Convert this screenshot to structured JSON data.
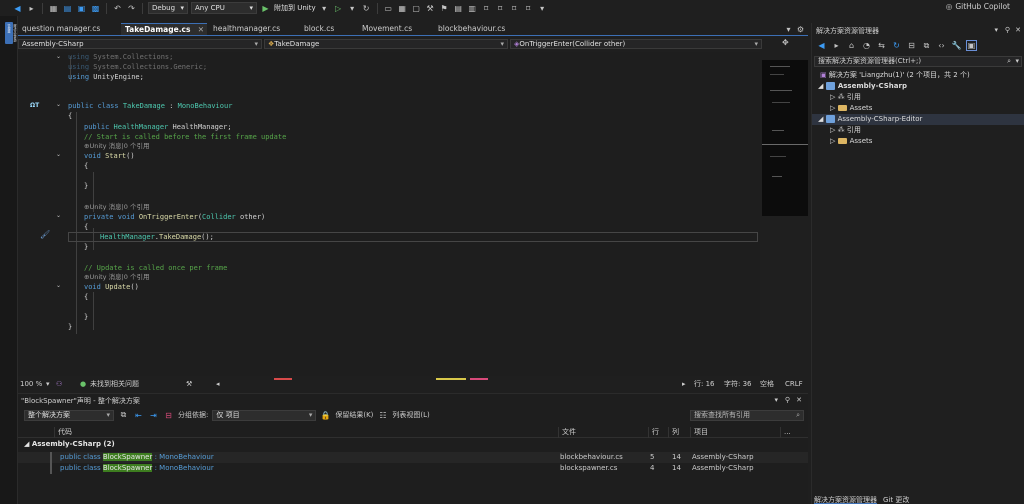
{
  "toolbar": {
    "configuration": "Debug",
    "platform": "Any CPU",
    "attach_label": "附加到 Unity",
    "copilot_label": "GitHub Copilot"
  },
  "left_strip": {
    "label": "解决方案资源管理器"
  },
  "doc_tabs": [
    {
      "label": "question manager.cs",
      "active": false
    },
    {
      "label": "TakeDamage.cs",
      "active": true
    },
    {
      "label": "healthmanager.cs",
      "active": false
    },
    {
      "label": "block.cs",
      "active": false
    },
    {
      "label": "Movement.cs",
      "active": false
    },
    {
      "label": "blockbehaviour.cs",
      "active": false
    }
  ],
  "nav_bar": {
    "project": "Assembly-CSharp",
    "class": "TakeDamage",
    "member": "OnTriggerEnter(Collider other)"
  },
  "code": {
    "l1": [
      "using",
      " System.Collections;"
    ],
    "l2": [
      "using",
      " System.Collections.Generic;"
    ],
    "l3": [
      "using",
      " UnityEngine;"
    ],
    "class_decl": [
      "public",
      "class",
      "TakeDamage",
      ":",
      "MonoBehaviour"
    ],
    "brace_open": "{",
    "field": [
      "public",
      "HealthManager",
      "HealthManager;"
    ],
    "comment_start": "// Start is called before the first frame update",
    "lens1": "Unity 消息|0 个引用",
    "start_sig": [
      "void",
      "Start",
      "()"
    ],
    "lens2": "Unity 消息|0 个引用",
    "trigger_sig": [
      "private",
      "void",
      "OnTriggerEnter",
      "(",
      "Collider",
      " other)"
    ],
    "take_damage_call": [
      "HealthManager",
      ".",
      "TakeDamage",
      "();"
    ],
    "comment_update": "// Update is called once per frame",
    "lens3": "Unity 消息|0 个引用",
    "update_sig": [
      "void",
      "Update",
      "()"
    ],
    "brace_close": "}"
  },
  "editor_status": {
    "zoom": "100 %",
    "issues": "未找到相关问题",
    "line": "行: 16",
    "char": "字符: 36",
    "spaces": "空格",
    "eol": "CRLF"
  },
  "find_panel": {
    "title": "\"BlockSpawner\"声明 - 整个解决方案",
    "scope": "整个解决方案",
    "group_by_label": "分组依据:",
    "group_by_value": "仅 项目",
    "keep_results": "保留结果(K)",
    "list_view": "列表视图(L)",
    "search_placeholder": "搜索查找所有引用",
    "columns": {
      "code": "代码",
      "file": "文件",
      "line": "行",
      "col": "列",
      "project": "项目"
    },
    "group_label": "Assembly-CSharp (2)",
    "rows": [
      {
        "pre": "public class ",
        "hl": "BlockSpawner",
        "post": " : MonoBehaviour",
        "file": "blockbehaviour.cs",
        "line": "5",
        "col": "14",
        "project": "Assembly-CSharp"
      },
      {
        "pre": "public class ",
        "hl": "BlockSpawner",
        "post": " : MonoBehaviour",
        "file": "blockspawner.cs",
        "line": "4",
        "col": "14",
        "project": "Assembly-CSharp"
      }
    ]
  },
  "solution_explorer": {
    "title": "解决方案资源管理器",
    "search_placeholder": "搜索解决方案资源管理器(Ctrl+;)",
    "solution": "解决方案 'Liangzhu(1)' (2 个项目，共 2 个)",
    "project1": "Assembly-CSharp",
    "project2": "Assembly-CSharp-Editor",
    "refs": "引用",
    "assets": "Assets",
    "bottom_tabs": [
      "解决方案资源管理器",
      "Git 更改"
    ]
  }
}
